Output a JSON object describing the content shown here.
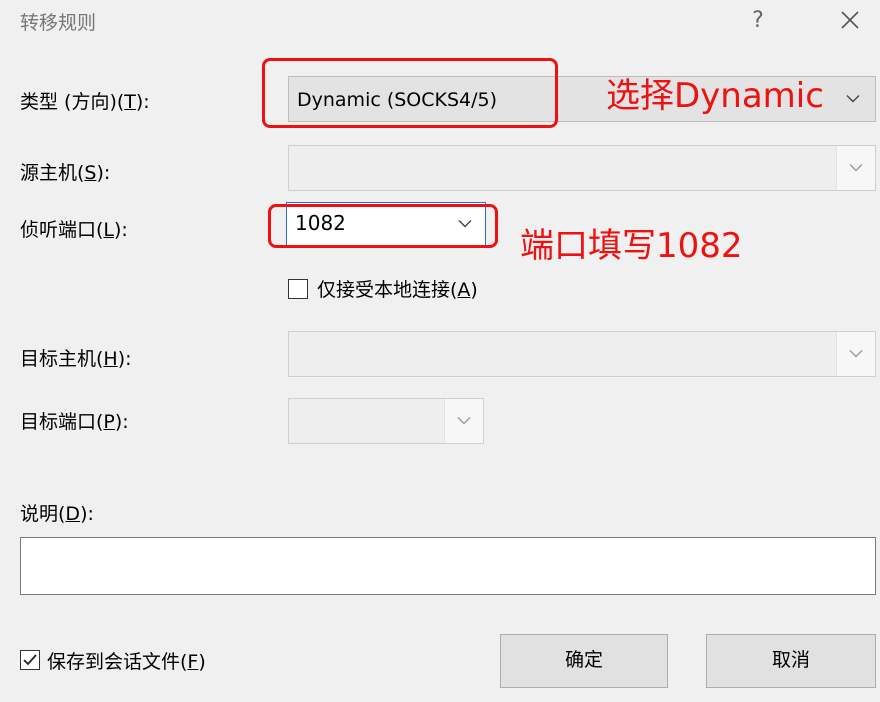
{
  "window": {
    "title": "转移规则",
    "help_glyph": "?",
    "close_glyph": "╳"
  },
  "form": {
    "type_label": "类型 (方向)(",
    "type_key": "T",
    "type_value": "Dynamic (SOCKS4/5)",
    "source_host_label": "源主机(",
    "source_host_key": "S",
    "listen_port_label": "侦听端口(",
    "listen_port_key": "L",
    "listen_port_value": "1082",
    "local_only_label": "仅接受本地连接(",
    "local_only_key": "A",
    "local_only_checked": false,
    "target_host_label": "目标主机(",
    "target_host_key": "H",
    "target_port_label": "目标端口(",
    "target_port_key": "P",
    "description_label": "说明(",
    "description_key": "D",
    "description_value": "",
    "label_suffix": "):",
    "save_label": "保存到会话文件(",
    "save_key": "F",
    "save_suffix": ")",
    "save_checked": true
  },
  "annotations": {
    "type_note": "选择Dynamic",
    "port_note": "端口填写1082",
    "color": "#ee1111"
  },
  "buttons": {
    "ok": "确定",
    "cancel": "取消"
  }
}
